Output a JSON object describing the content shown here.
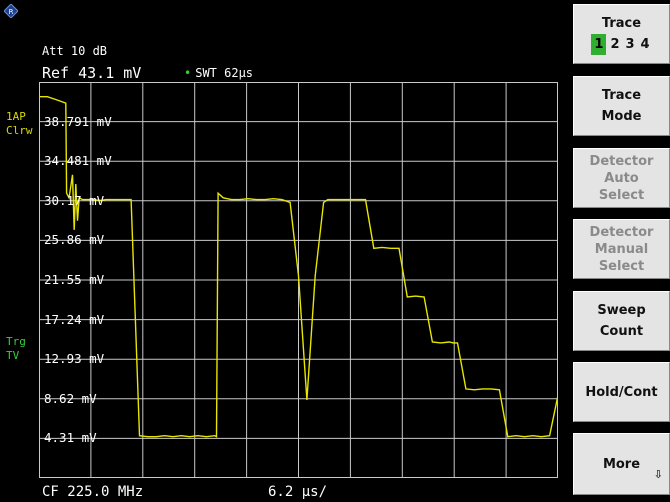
{
  "header": {
    "att": "Att  10 dB",
    "ref": "Ref  43.1 mV",
    "swt": "SWT 62µs"
  },
  "side_labels": {
    "trace": [
      "1AP",
      "Clrw"
    ],
    "trigger": [
      "Trg",
      "TV"
    ]
  },
  "y_axis_labels": [
    "38.791 mV",
    "34.481 mV",
    "30.17 mV",
    "25.86 mV",
    "21.55 mV",
    "17.24 mV",
    "12.93 mV",
    "8.62 mV",
    "4.31 mV"
  ],
  "footer": {
    "center_freq": "CF 225.0 MHz",
    "span": "6.2 µs/"
  },
  "softkeys": {
    "trace_title": "Trace",
    "trace_numbers": [
      "1",
      "2",
      "3",
      "4"
    ],
    "trace_active": "1",
    "trace_mode": [
      "Trace",
      "Mode"
    ],
    "detector_auto": [
      "Detector",
      "Auto",
      "Select"
    ],
    "detector_manual": [
      "Detector",
      "Manual",
      "Select"
    ],
    "sweep_count": [
      "Sweep",
      "Count"
    ],
    "hold_cont": "Hold/Cont",
    "more": "More"
  },
  "colors": {
    "trace": "#e6e600",
    "grid": "#c9c9c9",
    "trigger_label": "#35d035",
    "active_trace": "#2fae2f"
  },
  "chart_data": {
    "type": "line",
    "ylim": [
      0,
      43.1
    ],
    "y_unit": "mV",
    "x_unit": "µs",
    "x_divisions": 10,
    "x_per_division": 6.2,
    "series": [
      {
        "x": [
          0,
          1,
          2,
          3.2,
          3.3,
          3.6,
          4.0,
          4.2,
          4.4,
          4.6,
          4.8,
          5.2,
          6.2,
          7.4,
          8.0,
          10.0,
          11.0,
          12.0,
          13.0,
          14.0,
          15.0,
          16.0,
          17.0,
          18.0,
          19.0,
          20.0,
          21.0,
          21.2,
          21.4,
          22.0,
          23.0,
          24.0,
          25.0,
          26.0,
          27.0,
          28.0,
          29.0,
          30.0,
          31.0,
          32.0,
          33.0,
          34.0,
          34.5,
          35.0,
          35.5,
          36.0,
          36.5,
          37.0,
          37.5,
          38.0,
          38.5,
          39.0,
          40.0,
          41.0,
          42.0,
          43.0,
          44.0,
          45.0,
          46.0,
          47.0,
          48.0,
          49.0,
          49.5,
          50.0,
          51.0,
          52.0,
          53.0,
          54.0,
          55.0,
          56.0,
          57.0,
          58.0,
          59.0,
          60.0,
          61.0,
          62.0
        ],
        "y": [
          41.5,
          41.5,
          41.2,
          40.8,
          31.0,
          30.5,
          33.0,
          27.0,
          32.0,
          28.0,
          30.5,
          30.3,
          30.3,
          30.2,
          30.3,
          30.3,
          30.3,
          4.6,
          4.5,
          4.5,
          4.6,
          4.5,
          4.6,
          4.5,
          4.6,
          4.5,
          4.6,
          4.5,
          31.0,
          30.5,
          30.3,
          30.3,
          30.4,
          30.3,
          30.3,
          30.4,
          30.3,
          30.0,
          22.0,
          8.5,
          22.0,
          30.0,
          30.3,
          30.3,
          30.3,
          30.3,
          30.3,
          30.3,
          30.3,
          30.3,
          30.3,
          30.3,
          25.0,
          25.1,
          25.0,
          25.0,
          19.7,
          19.8,
          19.7,
          14.8,
          14.7,
          14.8,
          14.7,
          14.7,
          9.7,
          9.6,
          9.7,
          9.7,
          9.6,
          4.5,
          4.6,
          4.5,
          4.6,
          4.5,
          4.6,
          9.0
        ]
      }
    ]
  }
}
